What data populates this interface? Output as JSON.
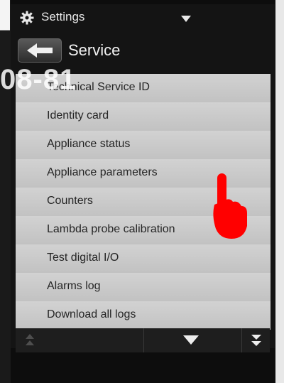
{
  "header": {
    "settings_label": "Settings",
    "title": "Service"
  },
  "watermark": "08-81",
  "menu": {
    "items": [
      {
        "label": "Technical Service ID"
      },
      {
        "label": "Identity card"
      },
      {
        "label": "Appliance status"
      },
      {
        "label": "Appliance parameters"
      },
      {
        "label": "Counters"
      },
      {
        "label": "Lambda probe calibration"
      },
      {
        "label": "Test digital I/O"
      },
      {
        "label": "Alarms log"
      },
      {
        "label": "Download all logs"
      }
    ]
  },
  "icons": {
    "settings": "gear-icon",
    "dropdown": "chevron-down-icon",
    "back": "back-arrow-icon",
    "scroll_down": "arrow-down-icon",
    "scroll_end": "double-arrow-down-icon",
    "pointer": "hand-pointer-icon"
  },
  "colors": {
    "menu_background": "#c9c9c9",
    "screen_background": "#141414",
    "pointer": "#ff0000"
  }
}
